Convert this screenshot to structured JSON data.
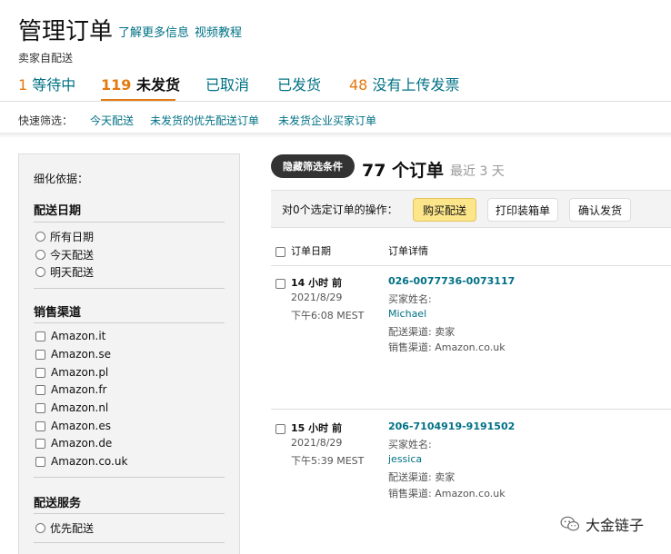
{
  "header": {
    "title": "管理订单",
    "learn_more": "了解更多信息",
    "video_tutorial": "视频教程",
    "subtitle": "卖家自配送"
  },
  "tabs": [
    {
      "count": "1",
      "label": " 等待中"
    },
    {
      "count": "119",
      "label": " 未发货"
    },
    {
      "count": "",
      "label": "已取消"
    },
    {
      "count": "",
      "label": "已发货"
    },
    {
      "count": "48",
      "label": " 没有上传发票"
    }
  ],
  "quick_filter": {
    "label": "快速筛选：",
    "items": [
      "今天配送",
      "未发货的优先配送订单",
      "未发货企业买家订单"
    ]
  },
  "sidebar": {
    "refine_label": "细化依据：",
    "delivery_date": {
      "heading": "配送日期",
      "options": [
        "所有日期",
        "今天配送",
        "明天配送"
      ]
    },
    "sales_channel": {
      "heading": "销售渠道",
      "options": [
        "Amazon.it",
        "Amazon.se",
        "Amazon.pl",
        "Amazon.fr",
        "Amazon.nl",
        "Amazon.es",
        "Amazon.de",
        "Amazon.co.uk"
      ]
    },
    "delivery_service": {
      "heading": "配送服务",
      "options": [
        "优先配送"
      ]
    }
  },
  "main": {
    "hide_filters_button": "隐藏筛选条件",
    "orders_count": "77 个订单",
    "orders_range": "最近 3 天",
    "action_label": "对0个选定订单的操作：",
    "buy_shipping": "购买配送",
    "print_packing": "打印装箱单",
    "confirm_ship": "确认发货",
    "col_order_date": "订单日期",
    "col_order_details": "订单详情"
  },
  "orders": [
    {
      "relative_time": "14 小时 前",
      "date": "2021/8/29",
      "time": "下午6:08 MEST",
      "order_id": "026-0077736-0073117",
      "buyer_label": "买家姓名:",
      "buyer": "Michael",
      "fulfillment": "配送渠道: 卖家",
      "channel": "销售渠道: Amazon.co.uk"
    },
    {
      "relative_time": "15 小时 前",
      "date": "2021/8/29",
      "time": "下午5:39 MEST",
      "order_id": "206-7104919-9191502",
      "buyer_label": "买家姓名:",
      "buyer": "jessica",
      "fulfillment": "配送渠道: 卖家",
      "channel": "销售渠道: Amazon.co.uk"
    }
  ],
  "watermark": {
    "text": "大金链子",
    "icon": "wechat-icon"
  }
}
